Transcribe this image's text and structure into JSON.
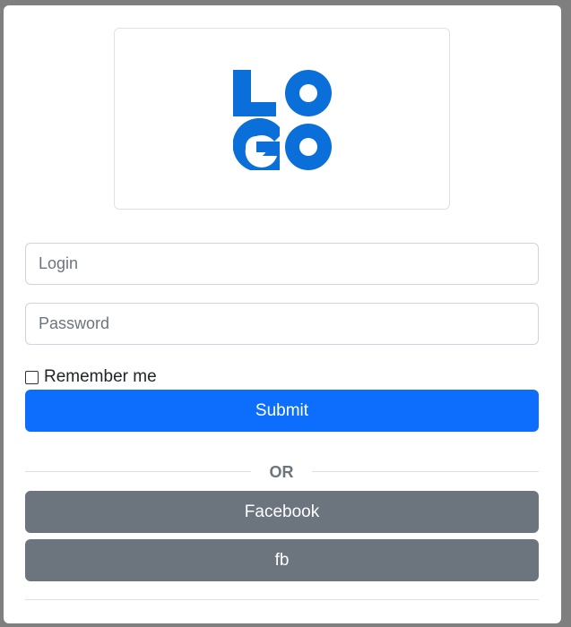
{
  "logo": {
    "line1": "LO",
    "line2": "GO",
    "color": "#0a6fd8"
  },
  "form": {
    "login_placeholder": "Login",
    "password_placeholder": "Password",
    "remember_label": "Remember me",
    "remember_checked": false,
    "submit_label": "Submit"
  },
  "divider": {
    "label": "OR"
  },
  "social": {
    "facebook_label": "Facebook",
    "fb_label": "fb"
  },
  "colors": {
    "primary": "#0d6efd",
    "secondary": "#6c757d",
    "border": "#dee2e6"
  }
}
